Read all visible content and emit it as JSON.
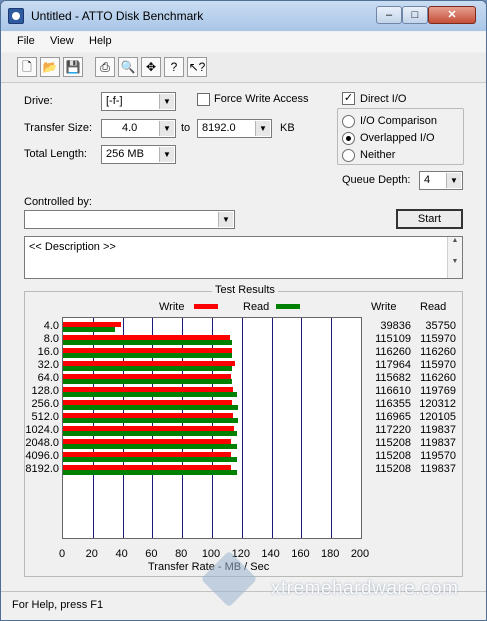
{
  "window": {
    "title": "Untitled - ATTO Disk Benchmark",
    "min": "–",
    "max": "□",
    "close": "✕"
  },
  "menu": [
    "File",
    "View",
    "Help"
  ],
  "toolbar": {
    "icons": [
      "new-icon",
      "open-icon",
      "save-icon",
      "print-icon",
      "print-preview-icon",
      "move-icon",
      "help-icon",
      "context-help-icon"
    ]
  },
  "form": {
    "drive_label": "Drive:",
    "drive_value": "[-f-]",
    "force_write_label": "Force Write Access",
    "force_write_checked": false,
    "transfer_size_label": "Transfer Size:",
    "transfer_from": "4.0",
    "to_label": "to",
    "transfer_to": "8192.0",
    "unit": "KB",
    "total_length_label": "Total Length:",
    "total_length_value": "256 MB",
    "direct_io_label": "Direct I/O",
    "direct_io_checked": true,
    "radio_io_comparison": "I/O Comparison",
    "radio_overlapped": "Overlapped I/O",
    "radio_neither": "Neither",
    "selected_radio": "Overlapped I/O",
    "queue_depth_label": "Queue Depth:",
    "queue_depth_value": "4",
    "controlled_by_label": "Controlled by:",
    "controlled_by_value": "",
    "start_button": "Start",
    "description": "<< Description >>"
  },
  "results": {
    "title": "Test Results",
    "legend_write": "Write",
    "legend_read": "Read",
    "col_write": "Write",
    "col_read": "Read",
    "write_color": "#ff0000",
    "read_color": "#008000"
  },
  "chart_data": {
    "type": "bar",
    "orientation": "horizontal",
    "title": "Test Results",
    "xlabel": "Transfer Rate - MB / Sec",
    "xlim": [
      0,
      200
    ],
    "xticks": [
      "0",
      "20",
      "40",
      "60",
      "80",
      "100",
      "120",
      "140",
      "160",
      "180",
      "200"
    ],
    "categories": [
      "4.0",
      "8.0",
      "16.0",
      "32.0",
      "64.0",
      "128.0",
      "256.0",
      "512.0",
      "1024.0",
      "2048.0",
      "4096.0",
      "8192.0"
    ],
    "series": [
      {
        "name": "Write",
        "color": "#ff0000",
        "values": [
          38.9,
          112.4,
          113.5,
          115.2,
          113.0,
          113.9,
          113.6,
          114.2,
          114.5,
          112.5,
          112.5,
          112.5
        ]
      },
      {
        "name": "Read",
        "color": "#008000",
        "values": [
          34.9,
          113.3,
          113.5,
          113.3,
          113.5,
          117.0,
          117.5,
          117.3,
          117.0,
          117.0,
          116.8,
          117.0
        ]
      }
    ],
    "write_text": [
      "39836",
      "115109",
      "116260",
      "117964",
      "115682",
      "116610",
      "116355",
      "116965",
      "117220",
      "115208",
      "115208",
      "115208"
    ],
    "read_text": [
      "35750",
      "115970",
      "116260",
      "115970",
      "116260",
      "119769",
      "120312",
      "120105",
      "119837",
      "119837",
      "119570",
      "119837"
    ],
    "grid": true,
    "legend_position": "top"
  },
  "status": {
    "text": "For Help, press F1"
  },
  "watermark": {
    "text": "xtremehardware.com"
  }
}
